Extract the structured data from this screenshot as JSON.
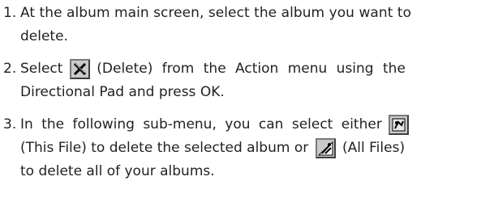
{
  "steps": [
    {
      "number": "1.",
      "line1": "At the album main screen, select the album you want to",
      "line2": "delete."
    },
    {
      "number": "2.",
      "select_word": "Select",
      "icon": "delete-x-icon",
      "line1_rest": "(Delete) from the Action menu using the",
      "line2": "Directional Pad and press OK."
    },
    {
      "number": "3.",
      "line1": "In the following sub-menu, you can select either",
      "icon_this_file": "this-file-icon",
      "line2_a": "(This File) to delete the selected album or",
      "icon_all_files": "all-files-icon",
      "line2_b": "(All Files)",
      "line3": "to delete all of your albums."
    }
  ]
}
